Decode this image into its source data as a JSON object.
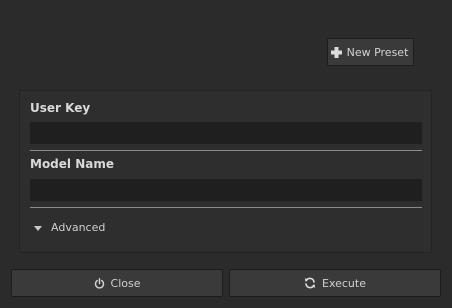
{
  "toolbar": {
    "new_preset_label": "New Preset",
    "new_preset_icon": "plus-icon"
  },
  "form": {
    "user_key": {
      "label": "User Key",
      "value": ""
    },
    "model_name": {
      "label": "Model Name",
      "value": ""
    },
    "advanced": {
      "label": "Advanced",
      "icon": "caret-down-icon",
      "expanded": false
    }
  },
  "footer": {
    "close_label": "Close",
    "close_icon": "power-icon",
    "execute_label": "Execute",
    "execute_icon": "refresh-icon"
  },
  "colors": {
    "background": "#2b2b2b",
    "panel": "#2e2e2e",
    "input": "#1f1f1f",
    "button": "#3a3a3a",
    "text": "#d6d6d6",
    "separator": "#8a8a8a"
  }
}
